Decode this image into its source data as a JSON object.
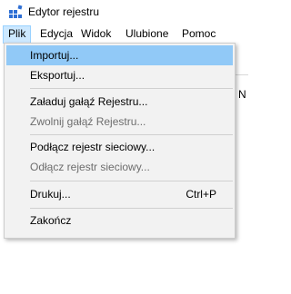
{
  "window": {
    "title": "Edytor rejestru",
    "app_icon": "registry-editor-icon"
  },
  "menubar": {
    "items": [
      {
        "label": "Plik",
        "active": true
      },
      {
        "label": "Edycja"
      },
      {
        "label": "Widok"
      },
      {
        "label": "Ulubione"
      },
      {
        "label": "Pomoc"
      }
    ]
  },
  "background": {
    "partial_text": "N"
  },
  "file_menu": {
    "items": [
      {
        "label": "Importuj...",
        "highlighted": true,
        "enabled": true
      },
      {
        "label": "Eksportuj...",
        "enabled": true
      },
      {
        "label": "Załaduj gałąź Rejestru...",
        "enabled": true
      },
      {
        "label": "Zwolnij gałąź Rejestru...",
        "enabled": false
      },
      {
        "label": "Podłącz rejestr sieciowy...",
        "enabled": true
      },
      {
        "label": "Odłącz rejestr sieciowy...",
        "enabled": false
      },
      {
        "label": "Drukuj...",
        "shortcut": "Ctrl+P",
        "enabled": true
      },
      {
        "label": "Zakończ",
        "enabled": true
      }
    ]
  },
  "colors": {
    "menu_background": "#f2f2f2",
    "highlight": "#91c9f7",
    "active_menu_fill": "#cce8ff",
    "active_menu_border": "#99d1ff",
    "disabled_text": "#6d6d6d"
  }
}
